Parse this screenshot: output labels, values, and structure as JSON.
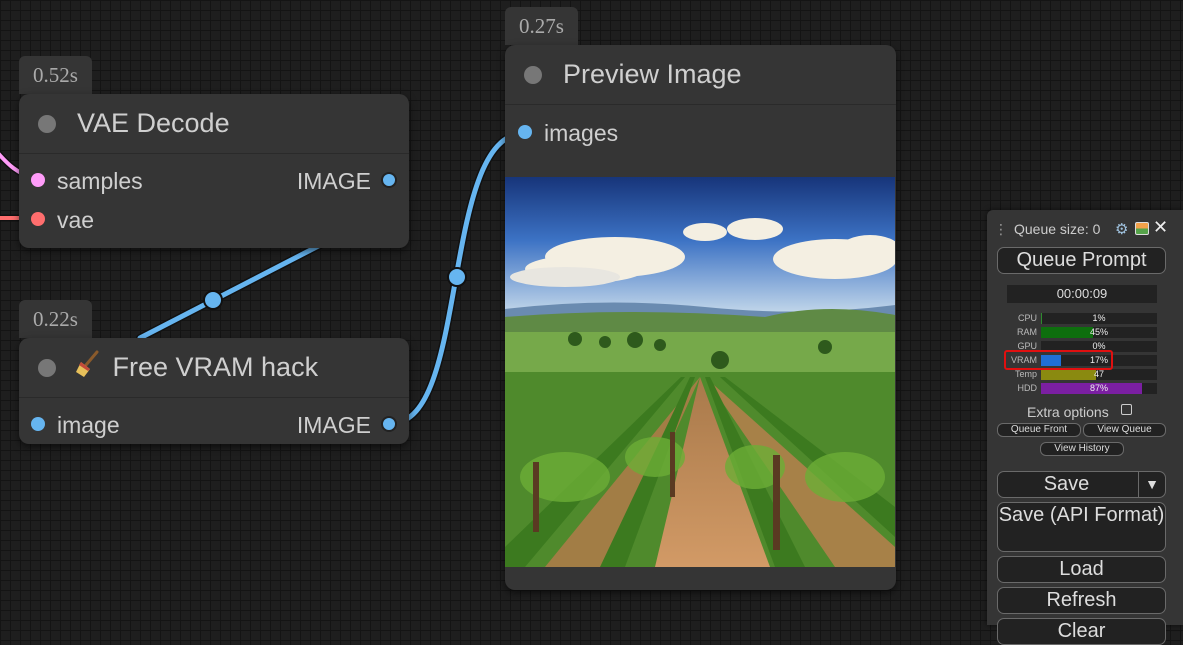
{
  "nodes": {
    "vae_decode": {
      "time": "0.52s",
      "title": "VAE Decode",
      "inputs": [
        "samples",
        "vae"
      ],
      "output": "IMAGE"
    },
    "free_vram": {
      "time": "0.22s",
      "icon": "broom-icon",
      "title": "Free VRAM hack",
      "input": "image",
      "output": "IMAGE"
    },
    "preview": {
      "time": "0.27s",
      "title": "Preview Image",
      "input": "images"
    }
  },
  "panel": {
    "queue_size": "Queue size: 0",
    "queue_prompt": "Queue Prompt",
    "timer": "00:00:09",
    "monitors": [
      {
        "label": "CPU",
        "value": "1%",
        "pct": 1,
        "color": "#2e8b2e"
      },
      {
        "label": "RAM",
        "value": "45%",
        "pct": 45,
        "color": "#0e6e0e"
      },
      {
        "label": "GPU",
        "value": "0%",
        "pct": 0,
        "color": "#2e8b2e"
      },
      {
        "label": "VRAM",
        "value": "17%",
        "pct": 17,
        "color": "#1f6fd6"
      },
      {
        "label": "Temp",
        "value": "47",
        "pct": 47,
        "color": "#8a8a10"
      },
      {
        "label": "HDD",
        "value": "87%",
        "pct": 87,
        "color": "#7b1fa2"
      }
    ],
    "extra_options": "Extra options",
    "queue_front": "Queue Front",
    "view_queue": "View Queue",
    "view_history": "View History",
    "save": "Save",
    "save_api": "Save (API Format)",
    "load": "Load",
    "refresh": "Refresh",
    "clear": "Clear"
  },
  "colors": {
    "wire_image": "#66b5f0",
    "samples_dot": "#ff9cf9",
    "vae_dot": "#ff6e6e",
    "vram_highlight": "#e01010"
  }
}
